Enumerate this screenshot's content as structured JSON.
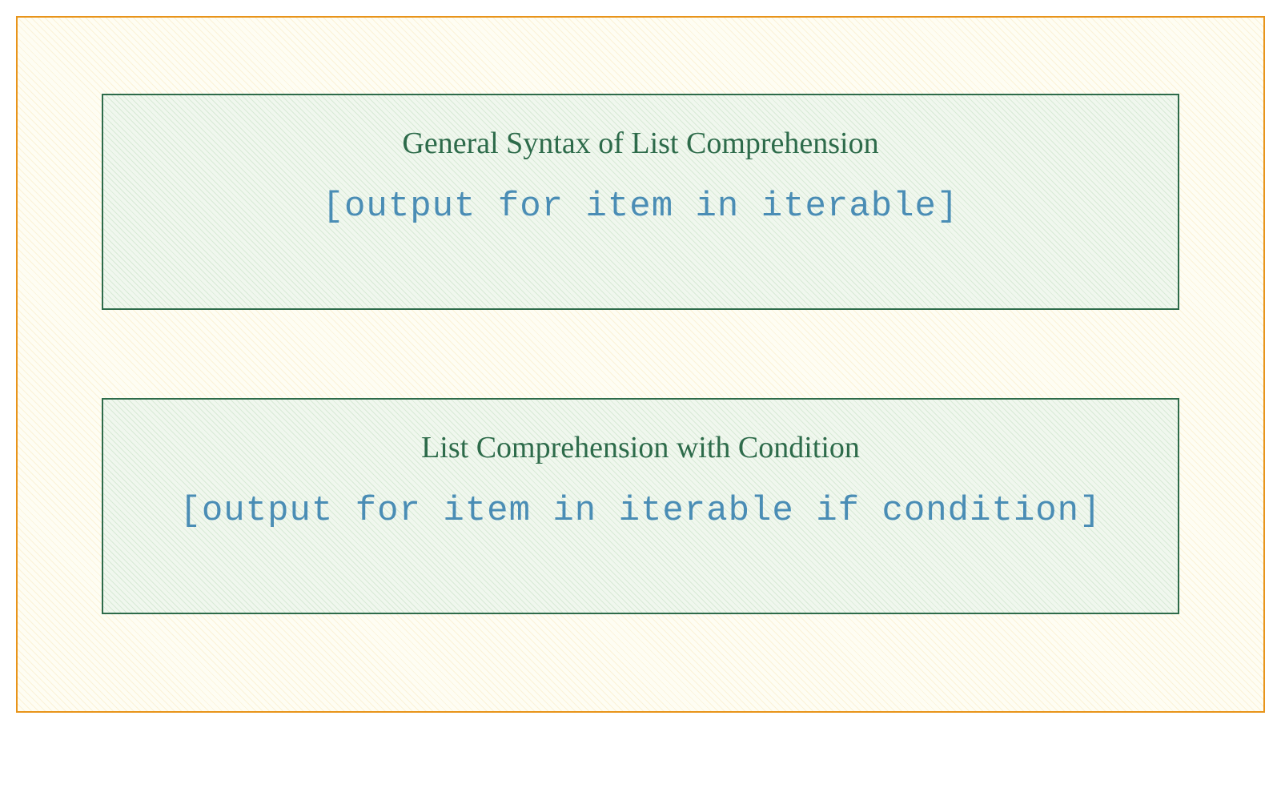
{
  "boxes": [
    {
      "title": "General Syntax of List Comprehension",
      "code": "[output for item in iterable]"
    },
    {
      "title": "List Comprehension with Condition",
      "code": "[output for item in iterable if condition]"
    }
  ]
}
